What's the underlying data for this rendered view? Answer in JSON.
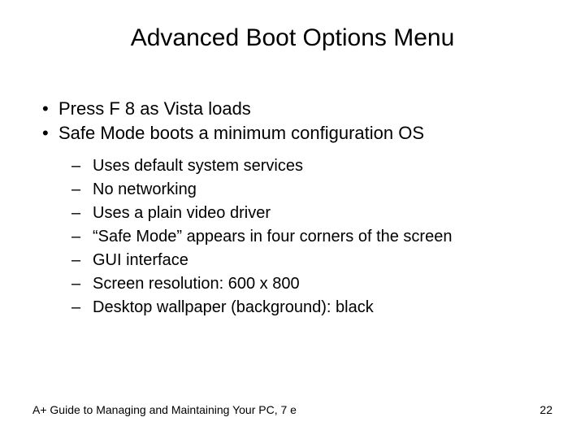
{
  "title": "Advanced Boot Options Menu",
  "bullets": [
    "Press F 8 as Vista loads",
    "Safe Mode boots a minimum configuration OS"
  ],
  "subBullets": [
    "Uses default system services",
    "No networking",
    "Uses a plain video driver",
    "“Safe Mode” appears in four corners of the screen",
    "GUI interface",
    "Screen resolution: 600 x 800",
    "Desktop wallpaper (background): black"
  ],
  "footer": {
    "left": "A+ Guide to Managing and Maintaining Your PC, 7 e",
    "right": "22"
  }
}
